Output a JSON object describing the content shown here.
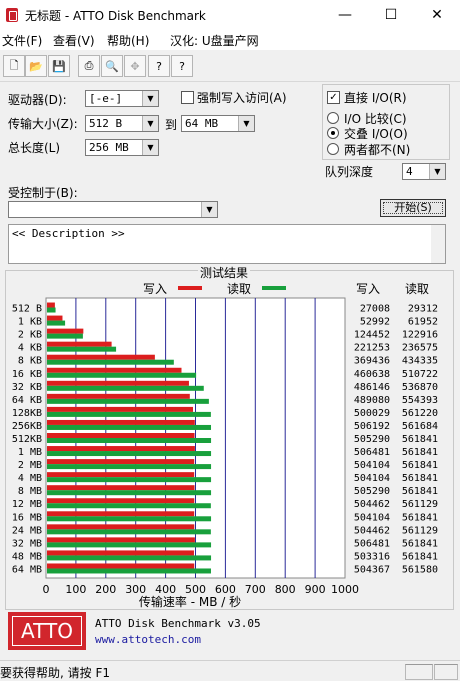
{
  "window": {
    "title": "无标题 - ATTO Disk Benchmark",
    "minimize_glyph": "—",
    "maximize_glyph": "☐",
    "close_glyph": "✕"
  },
  "menu": {
    "file": "文件(F)",
    "view": "查看(V)",
    "help": "帮助(H)",
    "localized": "汉化: U盘量产网"
  },
  "toolbar": {
    "icons": [
      "new-icon",
      "open-icon",
      "save-icon",
      "print-icon",
      "print-preview-icon",
      "move-icon",
      "help-icon",
      "context-help-icon"
    ],
    "glyphs": [
      "🗋",
      "📂",
      "💾",
      "⎙",
      "🔍",
      "✥",
      "?",
      "?"
    ]
  },
  "settings": {
    "drive_label": "驱动器(D):",
    "drive_value": "[-e-]",
    "force_write_label": "强制写入访问(A)",
    "force_write_checked": false,
    "transfer_size_label": "传输大小(Z):",
    "transfer_from": "512 B",
    "to_label": "到",
    "transfer_to": "64 MB",
    "total_length_label": "总长度(L)",
    "total_length_value": "256 MB",
    "direct_io_label": "直接 I/O(R)",
    "direct_io_checked": true,
    "io_compare_label": "I/O 比较(C)",
    "overlapped_io_label": "交叠 I/O(O)",
    "neither_label": "两者都不(N)",
    "io_mode_selected": "overlapped",
    "queue_depth_label": "队列深度",
    "queue_depth_value": "4",
    "controlled_by_label": "受控制于(B):",
    "controlled_by_value": "",
    "start_button": "开始(S)",
    "description": "<< Description >>"
  },
  "results": {
    "group_title": "测试结果",
    "write_legend": "写入",
    "read_legend": "读取",
    "write_col_header": "写入",
    "read_col_header": "读取",
    "write_color": "#dc1e1e",
    "read_color": "#18a03c"
  },
  "chart_data": {
    "type": "bar",
    "orientation": "horizontal",
    "xlabel": "传输速率 - MB / 秒",
    "xlim": [
      0,
      1000
    ],
    "xticks": [
      0,
      100,
      200,
      300,
      400,
      500,
      600,
      700,
      800,
      900,
      1000
    ],
    "grid": true,
    "categories": [
      "512 B",
      "1 KB",
      "2 KB",
      "4 KB",
      "8 KB",
      "16 KB",
      "32 KB",
      "64 KB",
      "128KB",
      "256KB",
      "512KB",
      "1 MB",
      "2 MB",
      "4 MB",
      "8 MB",
      "12 MB",
      "16 MB",
      "24 MB",
      "32 MB",
      "48 MB",
      "64 MB"
    ],
    "series": [
      {
        "name": "写入",
        "values": [
          27008,
          52992,
          124452,
          221253,
          369436,
          460638,
          486146,
          489080,
          500029,
          506192,
          505290,
          506481,
          504104,
          504104,
          505290,
          504462,
          504104,
          504462,
          506481,
          503316,
          504367
        ]
      },
      {
        "name": "读取",
        "values": [
          29312,
          61952,
          122916,
          236575,
          434335,
          510722,
          536870,
          554393,
          561220,
          561684,
          561841,
          561841,
          561841,
          561841,
          561841,
          561129,
          561841,
          561129,
          561841,
          561841,
          561580
        ]
      }
    ],
    "value_unit_note_kb": true
  },
  "footer": {
    "logo_text": "ATTO",
    "version": "ATTO Disk Benchmark v3.05",
    "url": "www.attotech.com"
  },
  "status": {
    "text": "要获得帮助, 请按 F1"
  }
}
